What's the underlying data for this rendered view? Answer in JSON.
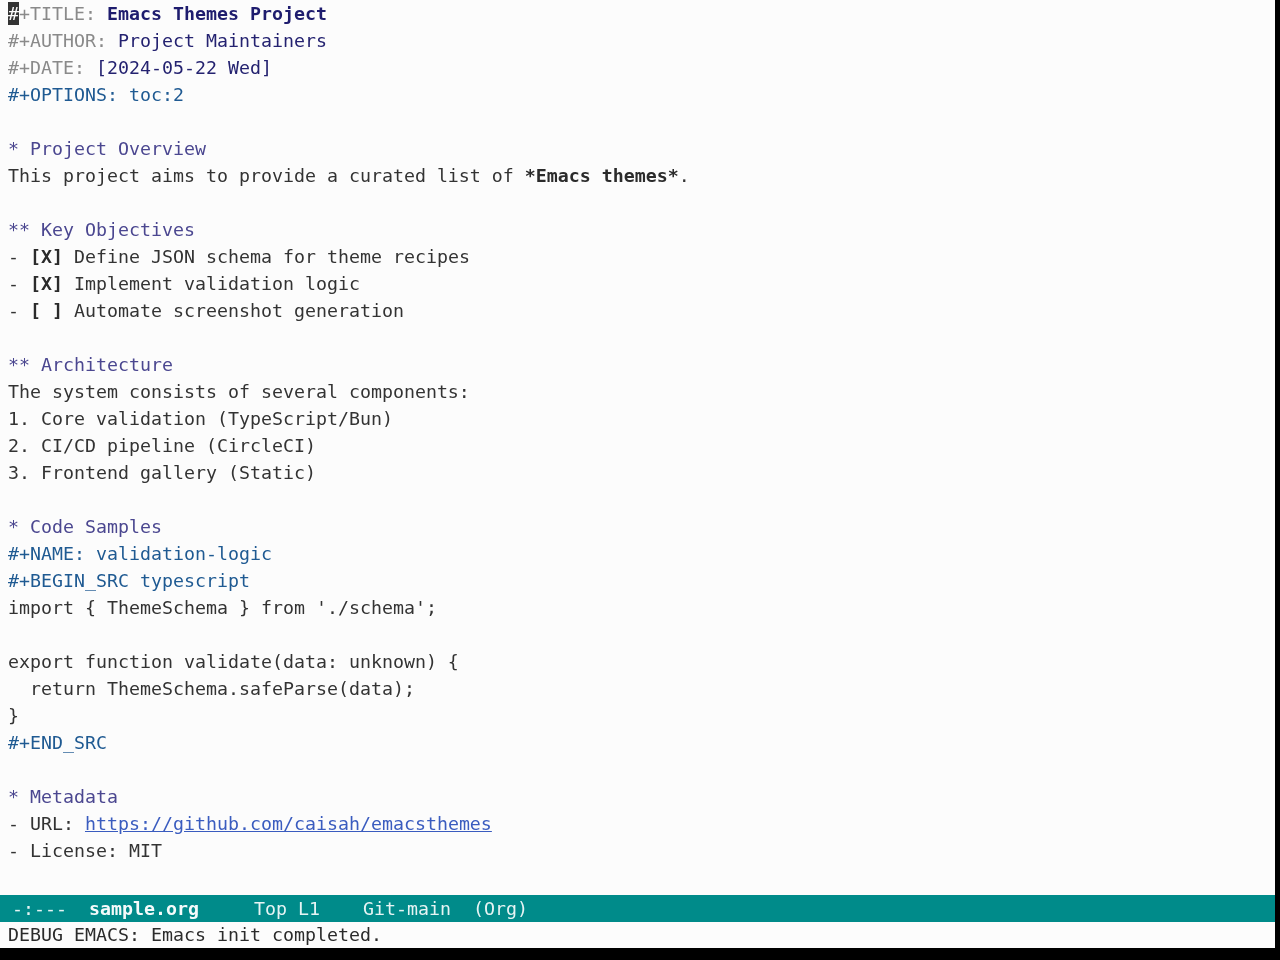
{
  "buffer": {
    "lines": [
      {
        "kind": "meta",
        "segments": [
          {
            "text": "#",
            "kind": "cursor"
          },
          {
            "text": "+TITLE: ",
            "kind": "plain"
          },
          {
            "text": "Emacs Themes Project",
            "kind": "title"
          }
        ]
      },
      {
        "kind": "meta",
        "segments": [
          {
            "text": "#+AUTHOR: ",
            "kind": "plain"
          },
          {
            "text": "Project Maintainers",
            "kind": "info"
          }
        ]
      },
      {
        "kind": "meta",
        "segments": [
          {
            "text": "#+DATE: ",
            "kind": "plain"
          },
          {
            "text": "[2024-05-22 Wed]",
            "kind": "info"
          }
        ]
      },
      {
        "kind": "keyword",
        "text": "#+OPTIONS: toc:2"
      },
      {
        "kind": "blank"
      },
      {
        "kind": "heading",
        "text": "* Project Overview"
      },
      {
        "kind": "text",
        "segments": [
          {
            "text": "This project aims to provide a curated list of ",
            "kind": "plain"
          },
          {
            "text": "*Emacs themes*",
            "kind": "bold"
          },
          {
            "text": ".",
            "kind": "plain"
          }
        ]
      },
      {
        "kind": "blank"
      },
      {
        "kind": "heading",
        "text": "** Key Objectives"
      },
      {
        "kind": "list",
        "segments": [
          {
            "text": "- ",
            "kind": "plain"
          },
          {
            "text": "[X]",
            "kind": "bold"
          },
          {
            "text": " Define JSON schema for theme recipes",
            "kind": "plain"
          }
        ]
      },
      {
        "kind": "list",
        "segments": [
          {
            "text": "- ",
            "kind": "plain"
          },
          {
            "text": "[X]",
            "kind": "bold"
          },
          {
            "text": " Implement validation logic",
            "kind": "plain"
          }
        ]
      },
      {
        "kind": "list",
        "segments": [
          {
            "text": "- ",
            "kind": "plain"
          },
          {
            "text": "[ ]",
            "kind": "bold"
          },
          {
            "text": " Automate screenshot generation",
            "kind": "plain"
          }
        ]
      },
      {
        "kind": "blank"
      },
      {
        "kind": "heading",
        "text": "** Architecture"
      },
      {
        "kind": "text",
        "text": "The system consists of several components:"
      },
      {
        "kind": "list",
        "text": "1. Core validation (TypeScript/Bun)"
      },
      {
        "kind": "list",
        "text": "2. CI/CD pipeline (CircleCI)"
      },
      {
        "kind": "list",
        "text": "3. Frontend gallery (Static)"
      },
      {
        "kind": "blank"
      },
      {
        "kind": "heading",
        "text": "* Code Samples"
      },
      {
        "kind": "keyword",
        "text": "#+NAME: validation-logic"
      },
      {
        "kind": "keyword",
        "text": "#+BEGIN_SRC typescript"
      },
      {
        "kind": "code",
        "text": "import { ThemeSchema } from './schema';"
      },
      {
        "kind": "blank"
      },
      {
        "kind": "code",
        "text": "export function validate(data: unknown) {"
      },
      {
        "kind": "code",
        "text": "  return ThemeSchema.safeParse(data);"
      },
      {
        "kind": "code",
        "text": "}"
      },
      {
        "kind": "keyword",
        "text": "#+END_SRC"
      },
      {
        "kind": "blank"
      },
      {
        "kind": "heading",
        "text": "* Metadata"
      },
      {
        "kind": "list",
        "segments": [
          {
            "text": "- URL: ",
            "kind": "plain"
          },
          {
            "text": "https://github.com/caisah/emacsthemes",
            "kind": "link"
          }
        ]
      },
      {
        "kind": "list",
        "text": "- License: MIT"
      }
    ]
  },
  "mode_line": {
    "status": "-:---",
    "buffer_name": "sample.org",
    "position": "Top L1",
    "vc_branch": "Git-main",
    "major_mode": "(Org)"
  },
  "echo_area": {
    "message": "DEBUG EMACS: Emacs init completed."
  }
}
